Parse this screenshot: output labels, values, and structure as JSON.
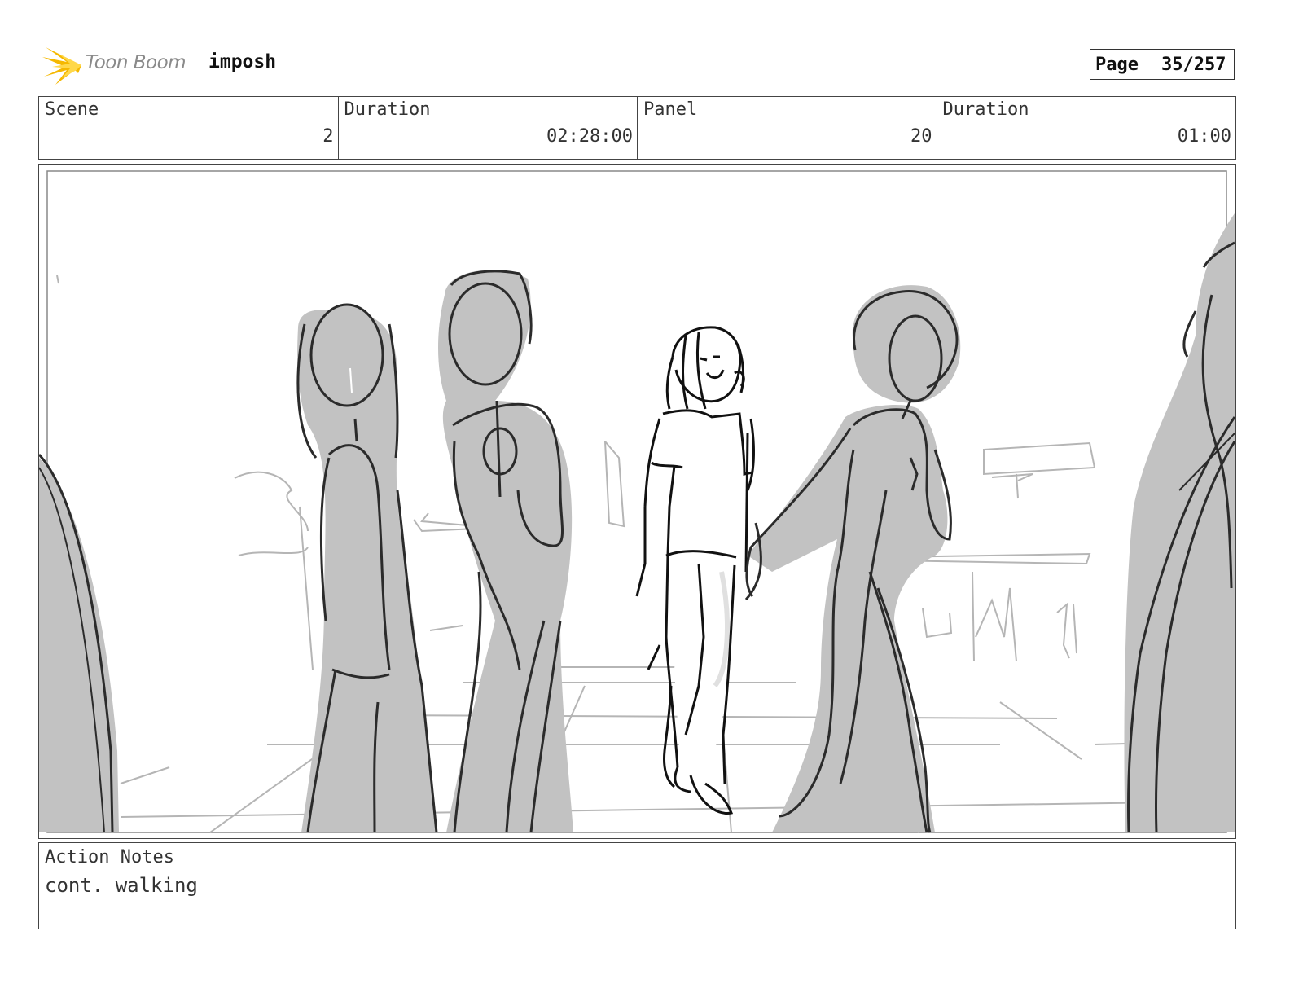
{
  "header": {
    "brand": "Toon Boom",
    "project": "imposh",
    "page_label": "Page",
    "page_value": "35/257"
  },
  "info": {
    "scene_label": "Scene",
    "scene_value": "2",
    "scene_duration_label": "Duration",
    "scene_duration_value": "02:28:00",
    "panel_label": "Panel",
    "panel_value": "20",
    "panel_duration_label": "Duration",
    "panel_duration_value": "01:00"
  },
  "notes": {
    "label": "Action Notes",
    "text": "cont. walking"
  },
  "colors": {
    "logo_accent": "#f5b800",
    "sketch_fill": "#c2c2c2",
    "sketch_line": "#2b2b2b"
  }
}
